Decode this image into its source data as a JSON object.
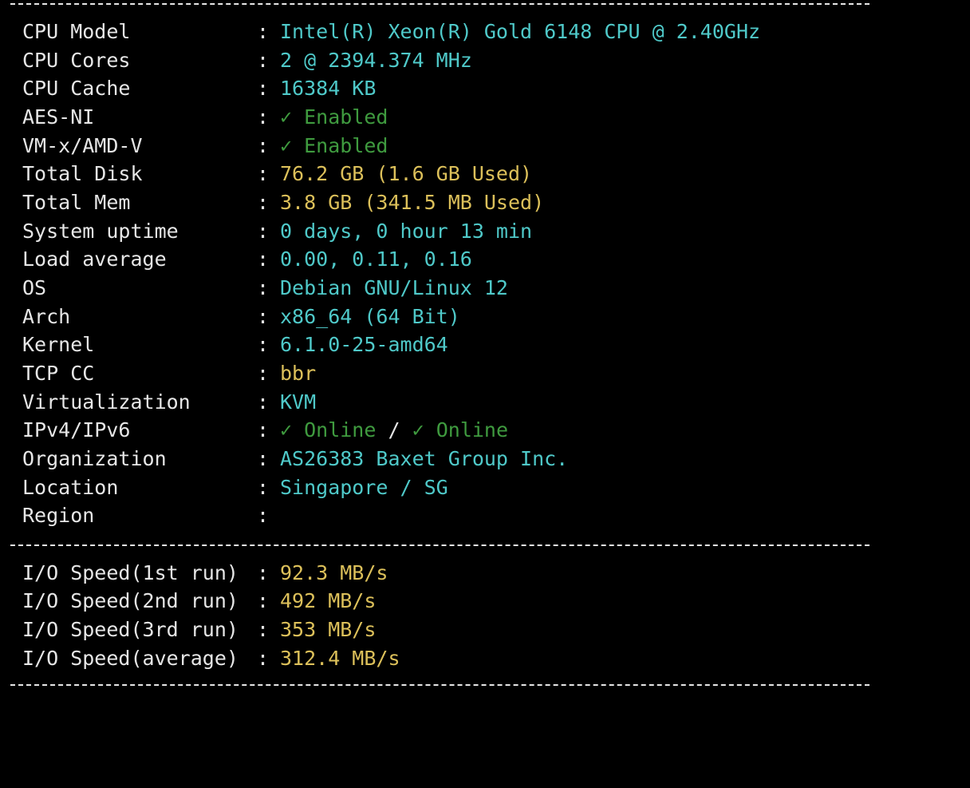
{
  "rows": [
    {
      "label": "CPU Model",
      "value": "Intel(R) Xeon(R) Gold 6148 CPU @ 2.40GHz"
    },
    {
      "label": "CPU Cores",
      "value": "2 @ 2394.374 MHz"
    },
    {
      "label": "CPU Cache",
      "value": "16384 KB"
    },
    {
      "label": "AES-NI",
      "value": "✓ Enabled"
    },
    {
      "label": "VM-x/AMD-V",
      "value": "✓ Enabled"
    },
    {
      "label": "Total Disk",
      "value": "76.2 GB (1.6 GB Used)"
    },
    {
      "label": "Total Mem",
      "value": "3.8 GB (341.5 MB Used)"
    },
    {
      "label": "System uptime",
      "value": "0 days, 0 hour 13 min"
    },
    {
      "label": "Load average",
      "value": "0.00, 0.11, 0.16"
    },
    {
      "label": "OS",
      "value": "Debian GNU/Linux 12"
    },
    {
      "label": "Arch",
      "value": "x86_64 (64 Bit)"
    },
    {
      "label": "Kernel",
      "value": "6.1.0-25-amd64"
    },
    {
      "label": "TCP CC",
      "value": "bbr"
    },
    {
      "label": "Virtualization",
      "value": "KVM"
    },
    {
      "label": "IPv4/IPv6",
      "ipv4": "✓ Online",
      "slash": "/",
      "ipv6": "✓ Online"
    },
    {
      "label": "Organization",
      "value": "AS26383 Baxet Group Inc."
    },
    {
      "label": "Location",
      "value": "Singapore / SG"
    },
    {
      "label": "Region",
      "value": ""
    }
  ],
  "io": [
    {
      "label": "I/O Speed(1st run)",
      "value": "92.3 MB/s"
    },
    {
      "label": "I/O Speed(2nd run)",
      "value": "492 MB/s"
    },
    {
      "label": "I/O Speed(3rd run)",
      "value": "353 MB/s"
    },
    {
      "label": "I/O Speed(average)",
      "value": "312.4 MB/s"
    }
  ],
  "separator_char": "-",
  "colon": ":",
  "colors": {
    "background": "#000000",
    "text": "#e6e6e6",
    "cyan": "#4fc9c9",
    "green": "#3f9b3f",
    "yellow": "#dcc05a"
  }
}
